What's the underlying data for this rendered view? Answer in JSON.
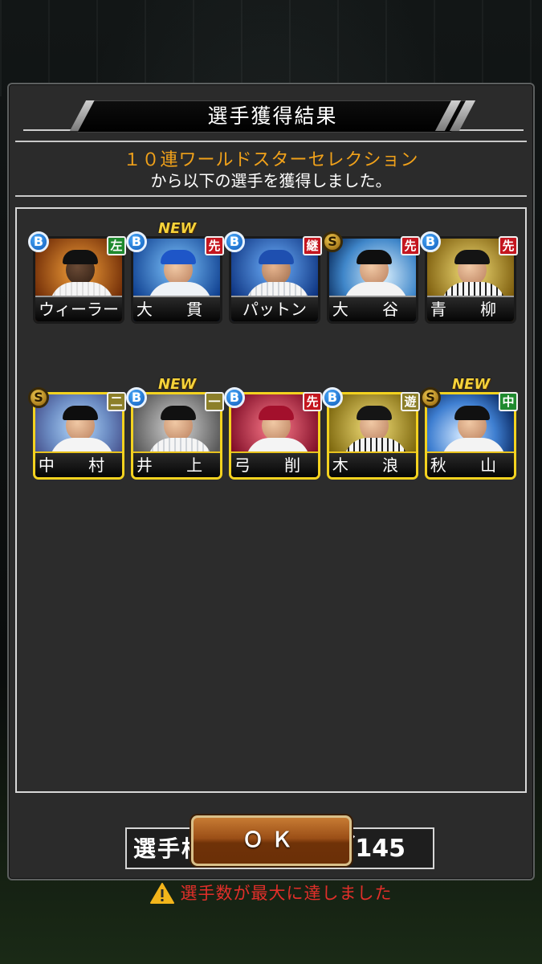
{
  "dialog": {
    "title": "選手獲得結果",
    "gacha_name": "１０連ワールドスターセレクション",
    "sub_message": "から以下の選手を獲得しました。"
  },
  "players": [
    {
      "name": "ウィーラー",
      "rank": "B",
      "position": "左",
      "is_new": false
    },
    {
      "name": "大 貫",
      "rank": "B",
      "position": "先",
      "is_new": true
    },
    {
      "name": "パットン",
      "rank": "B",
      "position": "継",
      "is_new": false
    },
    {
      "name": "大 谷",
      "rank": "S",
      "position": "先",
      "is_new": false
    },
    {
      "name": "青 柳",
      "rank": "B",
      "position": "先",
      "is_new": false
    },
    {
      "name": "中 村",
      "rank": "S",
      "position": "二",
      "is_new": false
    },
    {
      "name": "井 上",
      "rank": "B",
      "position": "一",
      "is_new": true
    },
    {
      "name": "弓 削",
      "rank": "B",
      "position": "先",
      "is_new": false
    },
    {
      "name": "木 浪",
      "rank": "B",
      "position": "遊",
      "is_new": false
    },
    {
      "name": "秋 山",
      "rank": "S",
      "position": "中",
      "is_new": true
    }
  ],
  "new_label": "NEW",
  "roster": {
    "label": "選手枠：",
    "value": "145／145"
  },
  "warning": "選手数が最大に達しました",
  "ok_button": "ＯＫ"
}
